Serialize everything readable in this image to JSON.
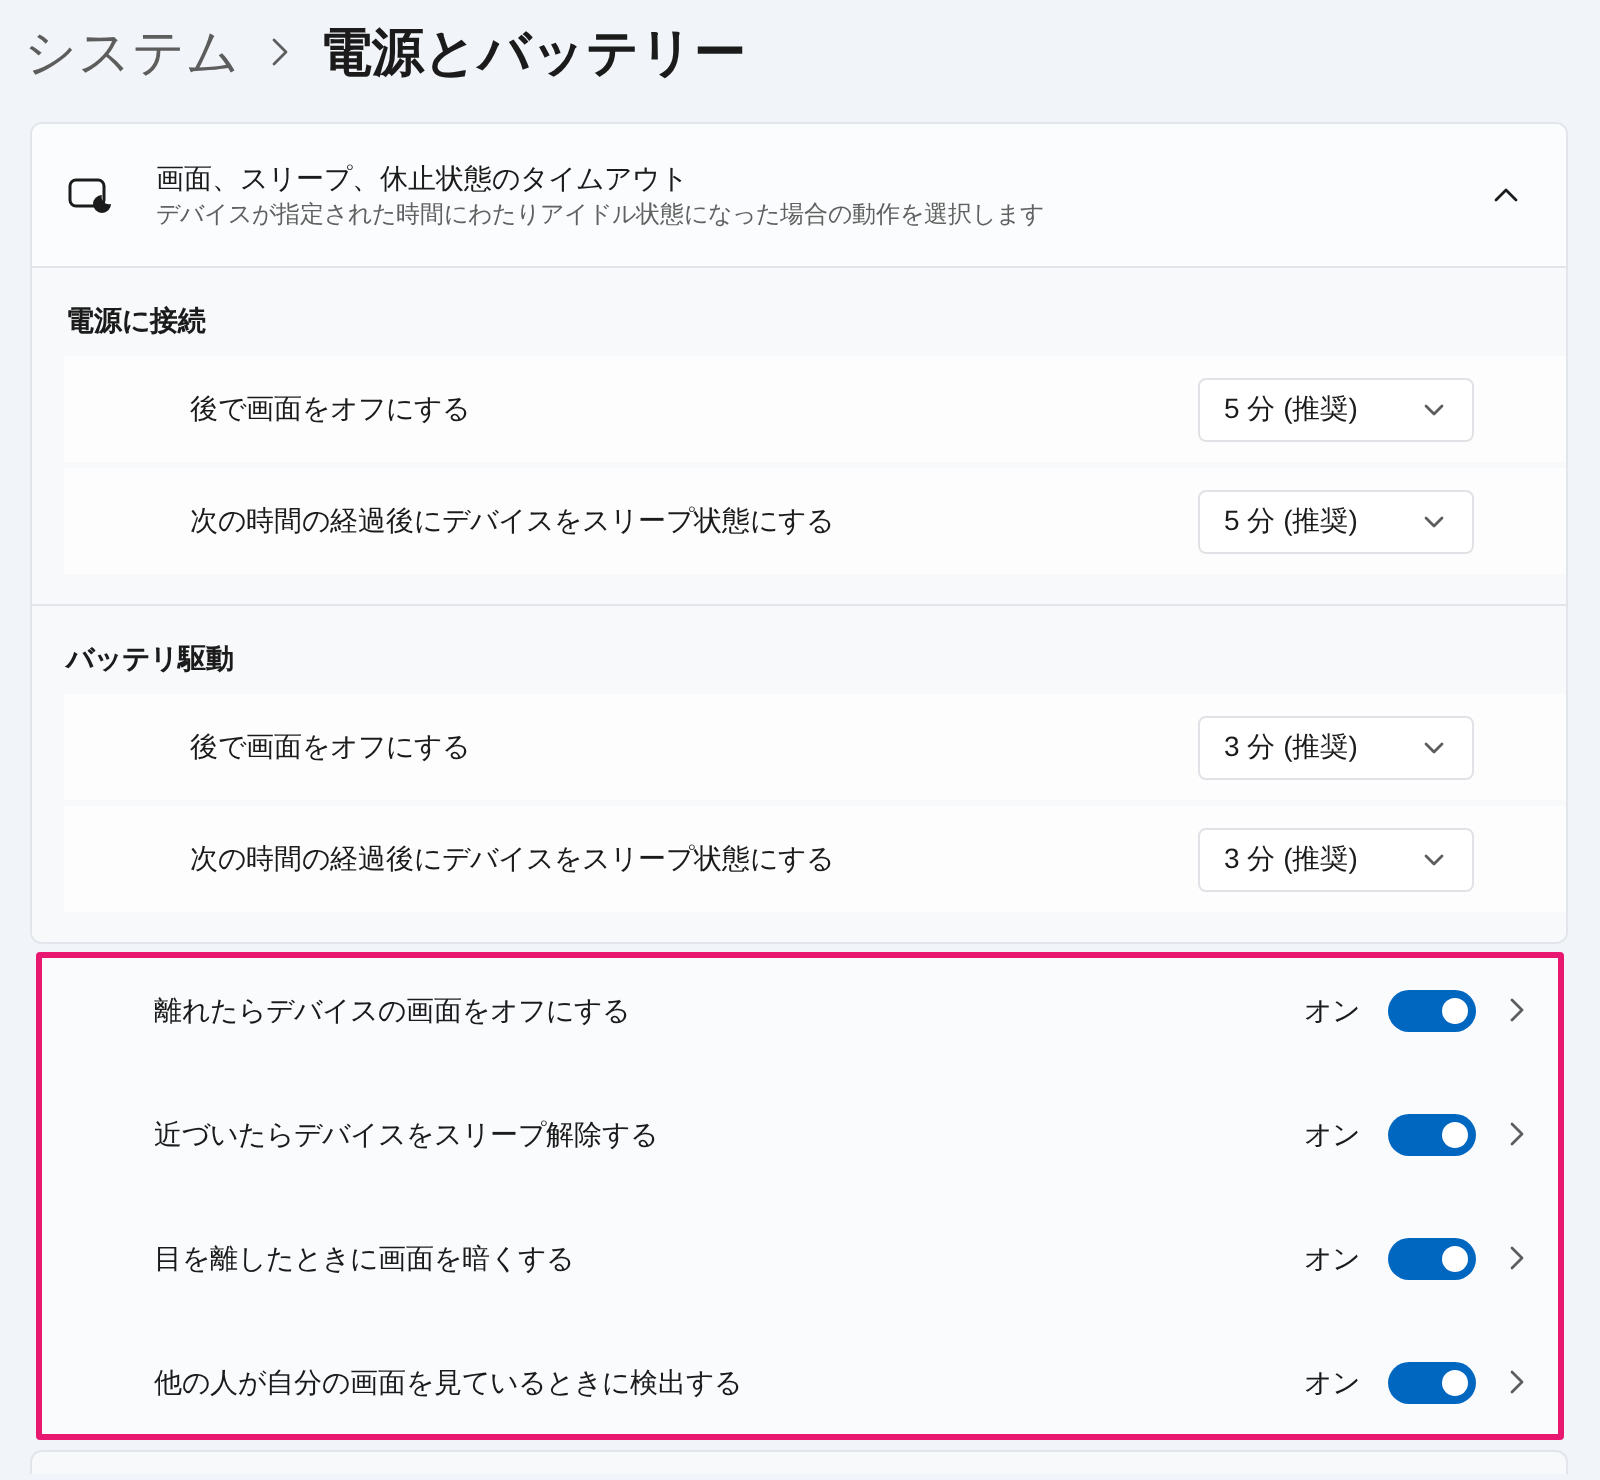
{
  "breadcrumb": {
    "parent": "システム",
    "current": "電源とバッテリー"
  },
  "timeout_card": {
    "title": "画面、スリープ、休止状態のタイムアウト",
    "description": "デバイスが指定された時間にわたりアイドル状態になった場合の動作を選択します",
    "expanded": true,
    "groups": [
      {
        "heading": "電源に接続",
        "rows": [
          {
            "label": "後で画面をオフにする",
            "value": "5 分 (推奨)"
          },
          {
            "label": "次の時間の経過後にデバイスをスリープ状態にする",
            "value": "5 分 (推奨)"
          }
        ]
      },
      {
        "heading": "バッテリ駆動",
        "rows": [
          {
            "label": "後で画面をオフにする",
            "value": "3 分 (推奨)"
          },
          {
            "label": "次の時間の経過後にデバイスをスリープ状態にする",
            "value": "3 分 (推奨)"
          }
        ]
      }
    ]
  },
  "presence_settings": {
    "highlighted": true,
    "rows": [
      {
        "label": "離れたらデバイスの画面をオフにする",
        "state_text": "オン",
        "on": true
      },
      {
        "label": "近づいたらデバイスをスリープ解除する",
        "state_text": "オン",
        "on": true
      },
      {
        "label": "目を離したときに画面を暗くする",
        "state_text": "オン",
        "on": true
      },
      {
        "label": "他の人が自分の画面を見ているときに検出する",
        "state_text": "オン",
        "on": true
      }
    ]
  }
}
